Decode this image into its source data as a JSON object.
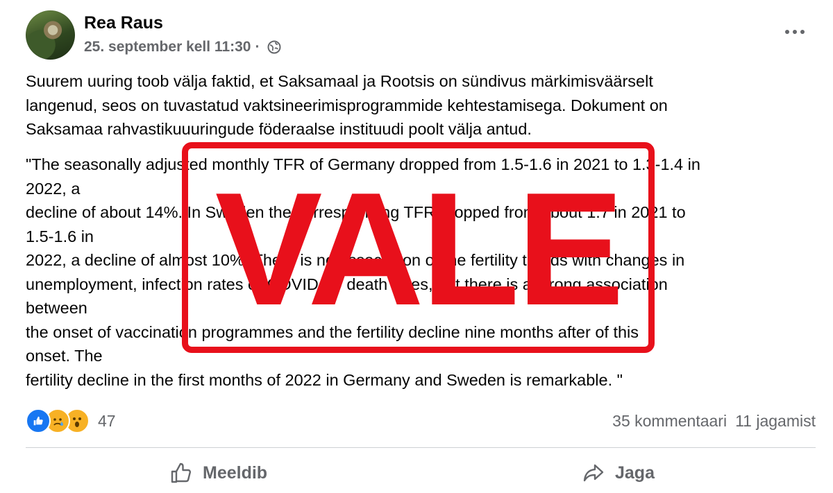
{
  "post": {
    "author": "Rea Raus",
    "timestamp": "25. september kell 11:30",
    "separator": "·",
    "privacy_icon": "globe-icon",
    "more_icon": "more-options-icon",
    "body_lines": [
      "Suurem uuring toob välja faktid, et Saksamaal ja Rootsis on sündivus märkimisväärselt",
      "langenud, seos on tuvastatud vaktsineerimisprogrammide kehtestamisega. Dokument on",
      "Saksamaa rahvastikuuuringude föderaalse instituudi poolt välja antud."
    ],
    "quote_lines": [
      "\"The seasonally adjusted monthly TFR of Germany dropped from 1.5-1.6 in 2021 to 1.3-1.4 in",
      "2022, a",
      "decline of about 14%. In Sweden the corresponding TFR dropped from about 1.7 in 2021 to",
      "1.5-1.6 in",
      "2022, a decline of almost 10%. There is no association of the fertility trends with changes in",
      "unemployment, infection rates or COVID-19 death rates, but there is a strong association",
      "between",
      "the onset of vaccination programmes and the fertility decline nine months after of this",
      "onset. The",
      "fertility decline in the first months of 2022 in Germany and Sweden is remarkable. \""
    ]
  },
  "stamp": {
    "text": "VALE",
    "color": "#e8101b"
  },
  "engagement": {
    "reactions": [
      "like-icon",
      "sad-icon",
      "wow-icon"
    ],
    "reaction_count": "47",
    "comments": "35 kommentaari",
    "shares": "11 jagamist"
  },
  "actions": {
    "like_label": "Meeldib",
    "share_label": "Jaga"
  }
}
